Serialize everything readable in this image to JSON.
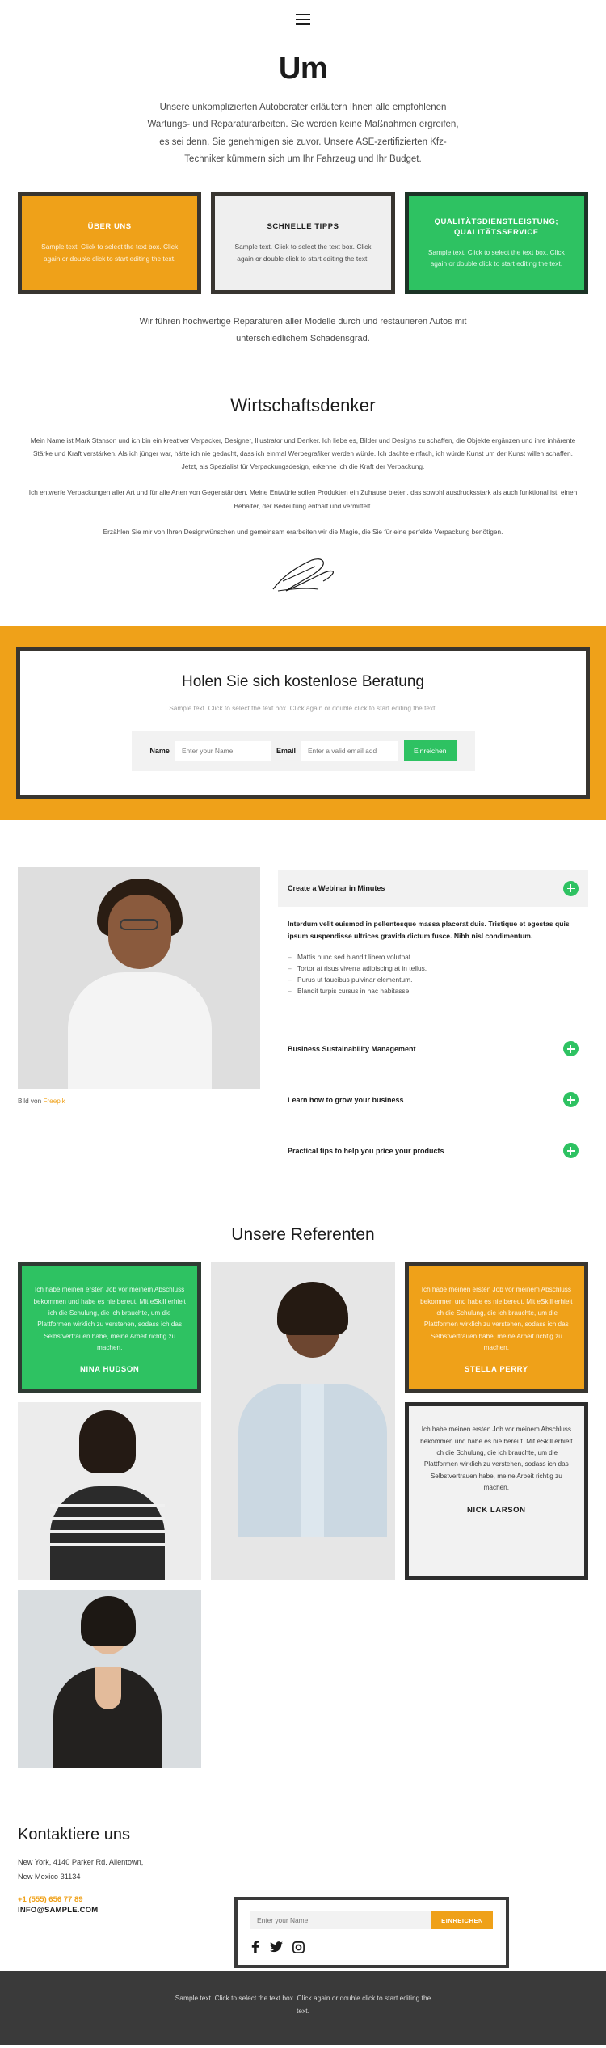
{
  "header": {
    "menu_icon": "hamburger-menu-icon"
  },
  "hero": {
    "title": "Um",
    "paragraph": "Unsere unkomplizierten Autoberater erläutern Ihnen alle empfohlenen Wartungs- und Reparaturarbeiten. Sie werden keine Maßnahmen ergreifen, es sei denn, Sie genehmigen sie zuvor. Unsere ASE-zertifizierten Kfz-Techniker kümmern sich um Ihr Fahrzeug und Ihr Budget."
  },
  "cards": [
    {
      "title": "ÜBER UNS",
      "text": "Sample text. Click to select the text box. Click again or double click to start editing the text.",
      "color": "#efa119"
    },
    {
      "title": "SCHNELLE TIPPS",
      "text": "Sample text. Click to select the text box. Click again or double click to start editing the text.",
      "color": "#efefef"
    },
    {
      "title": "QUALITÄTSDIENSTLEISTUNG; QUALITÄTSSERVICE",
      "text": "Sample text. Click to select the text box. Click again or double click to start editing the text.",
      "color": "#2ec262"
    }
  ],
  "subnote": "Wir führen hochwertige Reparaturen aller Modelle durch und restaurieren Autos mit unterschiedlichem Schadensgrad.",
  "bio": {
    "title": "Wirtschaftsdenker",
    "p1": "Mein Name ist Mark Stanson und ich bin ein kreativer Verpacker, Designer, Illustrator und Denker. Ich liebe es, Bilder und Designs zu schaffen, die Objekte ergänzen und ihre inhärente Stärke und Kraft verstärken. Als ich jünger war, hätte ich nie gedacht, dass ich einmal Werbegrafiker werden würde. Ich dachte einfach, ich würde Kunst um der Kunst willen schaffen. Jetzt, als Spezialist für Verpackungsdesign, erkenne ich die Kraft der Verpackung.",
    "p2": "Ich entwerfe Verpackungen aller Art und für alle Arten von Gegenständen. Meine Entwürfe sollen Produkten ein Zuhause bieten, das sowohl ausdrucksstark als auch funktional ist, einen Behälter, der Bedeutung enthält und vermittelt.",
    "p3": "Erzählen Sie mir von Ihren Designwünschen und gemeinsam erarbeiten wir die Magie, die Sie für eine perfekte Verpackung benötigen.",
    "signature_alt": "signature-mark-stanson"
  },
  "cta": {
    "title": "Holen Sie sich kostenlose Beratung",
    "subtitle": "Sample text. Click to select the text box. Click again or double click to start editing the text.",
    "name_label": "Name",
    "name_placeholder": "Enter your Name",
    "email_label": "Email",
    "email_placeholder": "Enter a valid email add",
    "submit_label": "Einreichen",
    "band_color": "#efa119",
    "button_color": "#2ec262"
  },
  "feature": {
    "image_caption_prefix": "Bild von ",
    "image_caption_link": "Freepik",
    "accordion": [
      {
        "title": "Create a Webinar in Minutes",
        "open": true
      },
      {
        "title": "Business Sustainability Management",
        "open": false
      },
      {
        "title": "Learn how to grow your business",
        "open": false
      },
      {
        "title": "Practical tips to help you price your products",
        "open": false
      }
    ],
    "open_body": {
      "lead": "Interdum velit euismod in pellentesque massa placerat duis. Tristique et egestas quis ipsum suspendisse ultrices gravida dictum fusce. Nibh nisl condimentum.",
      "bullets": [
        "Mattis nunc sed blandit libero volutpat.",
        "Tortor at risus viverra adipiscing at in tellus.",
        "Purus ut faucibus pulvinar elementum.",
        "Blandit turpis cursus in hac habitasse."
      ]
    }
  },
  "speakers": {
    "title": "Unsere Referenten",
    "quote_text": "Ich habe meinen ersten Job vor meinem Abschluss bekommen und habe es nie bereut. Mit eSkill erhielt ich die Schulung, die ich brauchte, um die Plattformen wirklich zu verstehen, sodass ich das Selbstvertrauen habe, meine Arbeit richtig zu machen.",
    "items": [
      {
        "name": "NINA HUDSON",
        "style": "green"
      },
      {
        "name": "STELLA PERRY",
        "style": "orange"
      },
      {
        "name": "NICK LARSON",
        "style": "light"
      }
    ]
  },
  "contact": {
    "title": "Kontaktiere uns",
    "address_line1": "New York, 4140 Parker Rd. Allentown,",
    "address_line2": "New Mexico 31134",
    "phone": "+1 (555) 656 77 89",
    "email": "INFO@SAMPLE.COM",
    "subscribe_placeholder": "Enter your Name",
    "subscribe_button": "EINREICHEN",
    "socials": [
      "facebook-icon",
      "twitter-icon",
      "instagram-icon"
    ]
  },
  "footer": {
    "text": "Sample text. Click to select the text box. Click again or double click to start editing the text."
  }
}
